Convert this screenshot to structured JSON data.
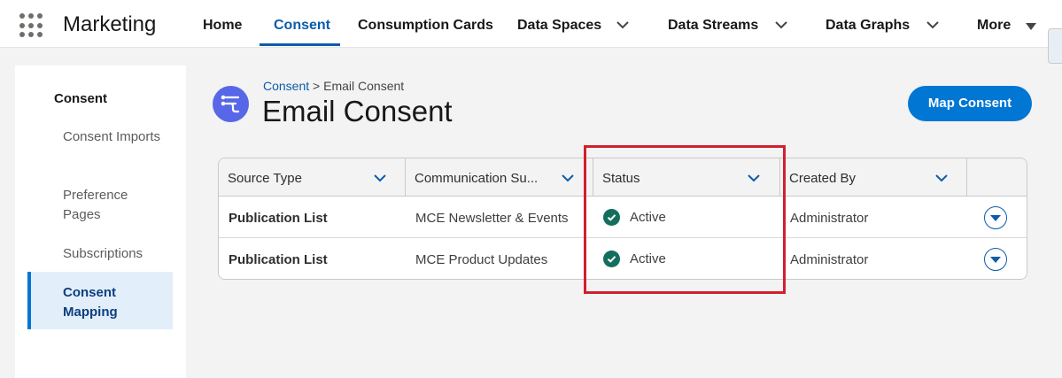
{
  "app": {
    "name": "Marketing"
  },
  "nav": {
    "items": [
      {
        "label": "Home"
      },
      {
        "label": "Consent"
      },
      {
        "label": "Consumption Cards"
      },
      {
        "label": "Data Spaces"
      },
      {
        "label": "Data Streams"
      },
      {
        "label": "Data Graphs"
      },
      {
        "label": "More"
      }
    ],
    "active": "Consent"
  },
  "sidebar": {
    "heading": "Consent",
    "items": [
      {
        "label": "Consent Imports"
      },
      {
        "label": "Preference Pages"
      },
      {
        "label": "Subscriptions"
      },
      {
        "label": "Consent Mapping"
      }
    ],
    "active": "Consent Mapping"
  },
  "header": {
    "breadcrumb_link": "Consent",
    "breadcrumb_sep": ">",
    "breadcrumb_current": "Email Consent",
    "title": "Email Consent",
    "primary_button": "Map Consent",
    "icon": "data-mapping-icon"
  },
  "table": {
    "columns": [
      {
        "label": "Source Type"
      },
      {
        "label": "Communication Su..."
      },
      {
        "label": "Status"
      },
      {
        "label": "Created By"
      }
    ],
    "rows": [
      {
        "source_type": "Publication List",
        "communication": "MCE Newsletter & Events",
        "status": "Active",
        "created_by": "Administrator"
      },
      {
        "source_type": "Publication List",
        "communication": "MCE Product Updates",
        "status": "Active",
        "created_by": "Administrator"
      }
    ]
  },
  "colors": {
    "accent": "#0176d3",
    "active_nav": "#0b5cab",
    "status_ok": "#146e5e",
    "highlight": "#d0202d"
  }
}
